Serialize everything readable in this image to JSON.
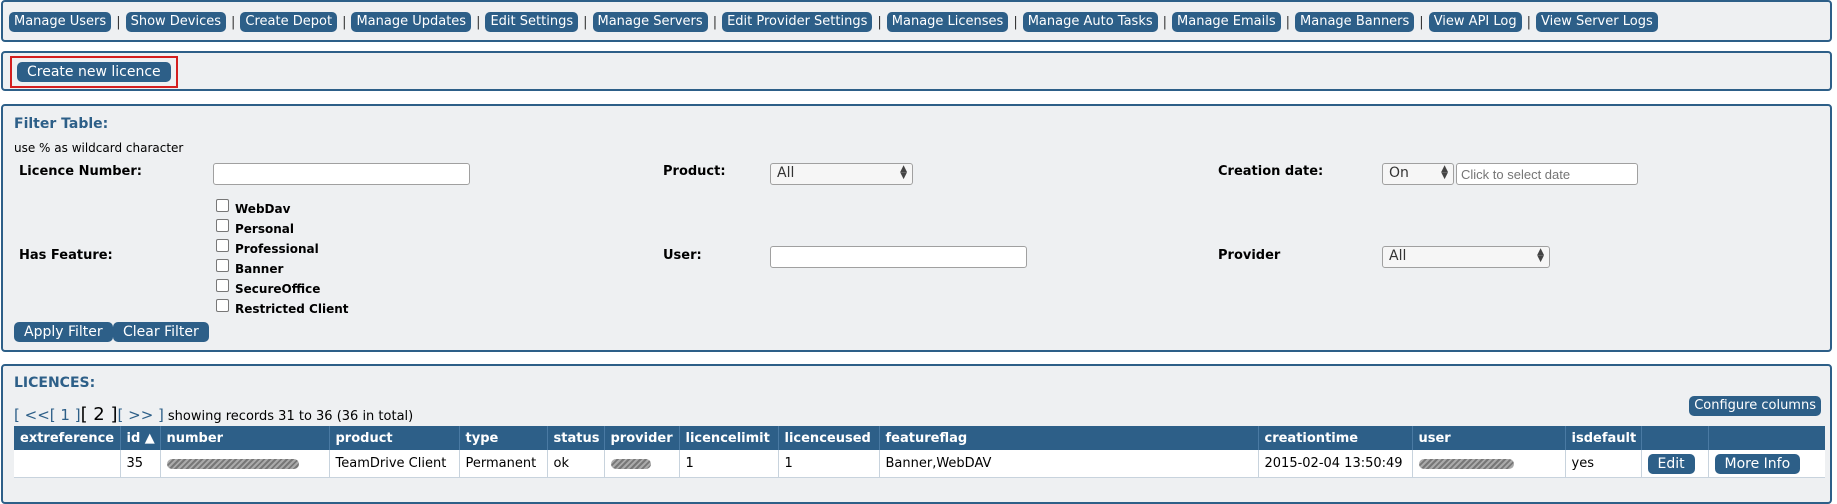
{
  "nav": {
    "items": [
      {
        "label": "Manage Users"
      },
      {
        "label": "Show Devices"
      },
      {
        "label": "Create Depot"
      },
      {
        "label": "Manage Updates"
      },
      {
        "label": "Edit Settings"
      },
      {
        "label": "Manage Servers"
      },
      {
        "label": "Edit Provider Settings"
      },
      {
        "label": "Manage Licenses"
      },
      {
        "label": "Manage Auto Tasks"
      },
      {
        "label": "Manage Emails"
      },
      {
        "label": "Manage Banners"
      },
      {
        "label": "View API Log"
      },
      {
        "label": "View Server Logs"
      }
    ],
    "separator": "|"
  },
  "create_button": "Create new licence",
  "filter": {
    "title": "Filter Table:",
    "hint": "use % as wildcard character",
    "licence_number_label": "Licence Number:",
    "licence_number_value": "",
    "product_label": "Product:",
    "product_value": "All",
    "creation_date_label": "Creation date:",
    "creation_date_mode": "On",
    "creation_date_placeholder": "Click to select date",
    "has_feature_label": "Has Feature:",
    "features": [
      {
        "label": "WebDav",
        "checked": false
      },
      {
        "label": "Personal",
        "checked": false
      },
      {
        "label": "Professional",
        "checked": false
      },
      {
        "label": "Banner",
        "checked": false
      },
      {
        "label": "SecureOffice",
        "checked": false
      },
      {
        "label": "Restricted Client",
        "checked": false
      }
    ],
    "user_label": "User:",
    "user_value": "",
    "provider_label": "Provider",
    "provider_value": "All",
    "apply_button": "Apply Filter",
    "clear_button": "Clear Filter"
  },
  "licences": {
    "title": "LICENCES:",
    "configure_button": "Configure columns",
    "pager": {
      "first": "[ <<",
      "page1": "[ 1 ]",
      "current": "[ 2 ]",
      "last": "[ >> ]",
      "summary": "showing records 31 to 36 (36 in total)"
    },
    "columns": [
      "extreference",
      "id ▲",
      "number",
      "product",
      "type",
      "status",
      "provider",
      "licencelimit",
      "licenceused",
      "featureflag",
      "creationtime",
      "user",
      "isdefault",
      "",
      ""
    ],
    "rows": [
      {
        "extreference": "",
        "id": "35",
        "product": "TeamDrive Client",
        "type": "Permanent",
        "status": "ok",
        "licencelimit": "1",
        "licenceused": "1",
        "featureflag": "Banner,WebDAV",
        "creationtime": "2015-02-04 13:50:49",
        "isdefault": "yes",
        "edit_label": "Edit",
        "more_label": "More Info"
      }
    ]
  }
}
